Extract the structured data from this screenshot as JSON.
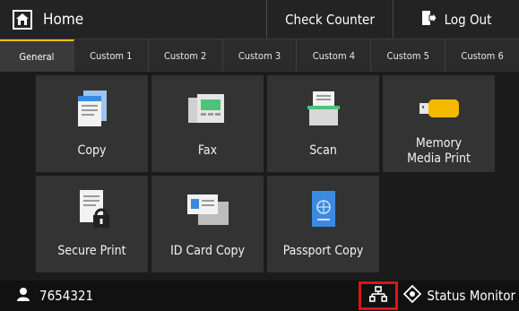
{
  "header": {
    "home_label": "Home",
    "check_counter_label": "Check Counter",
    "logout_label": "Log Out"
  },
  "tabs": [
    {
      "label": "General",
      "active": true
    },
    {
      "label": "Custom 1"
    },
    {
      "label": "Custom 2"
    },
    {
      "label": "Custom 3"
    },
    {
      "label": "Custom 4"
    },
    {
      "label": "Custom 5"
    },
    {
      "label": "Custom 6"
    }
  ],
  "tiles": [
    {
      "label": "Copy",
      "icon": "copy-icon"
    },
    {
      "label": "Fax",
      "icon": "fax-icon"
    },
    {
      "label": "Scan",
      "icon": "scan-icon"
    },
    {
      "label": "Memory Media Print",
      "icon": "usb-memory-icon"
    },
    {
      "label": "Secure Print",
      "icon": "secure-print-icon"
    },
    {
      "label": "ID Card Copy",
      "icon": "id-card-icon"
    },
    {
      "label": "Passport Copy",
      "icon": "passport-icon"
    }
  ],
  "status_bar": {
    "user_id": "7654321",
    "status_monitor_label": "Status Monitor"
  },
  "colors": {
    "accent": "#f2c100",
    "highlight": "#e01414",
    "doc_blue": "#3a8be0",
    "fax_green": "#4ec27a",
    "usb_yellow": "#f5b800"
  }
}
